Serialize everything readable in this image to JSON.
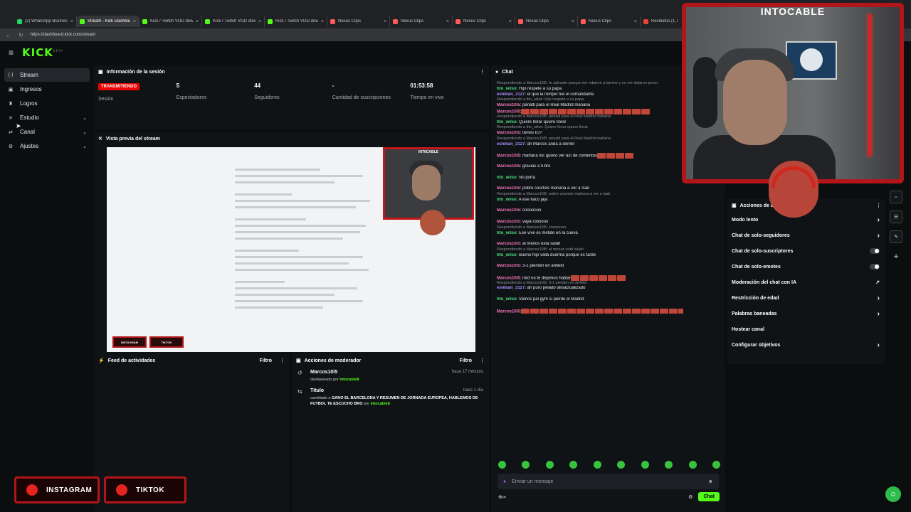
{
  "browser": {
    "tabs": [
      {
        "title": "(2) WhatsApp Business",
        "color": "#25d366",
        "active": false
      },
      {
        "title": "Stream - Kick Dashboard",
        "color": "#53fc18",
        "active": true
      },
      {
        "title": "Kick / Twitch VOD dow",
        "color": "#53fc18",
        "active": false
      },
      {
        "title": "Kick / Twitch VOD dow",
        "color": "#53fc18",
        "active": false
      },
      {
        "title": "Kick / Twitch VOD dow",
        "color": "#53fc18",
        "active": false
      },
      {
        "title": "Nexus Clips",
        "color": "#ff5a5a",
        "active": false
      },
      {
        "title": "Nexus Clips",
        "color": "#ff5a5a",
        "active": false
      },
      {
        "title": "Nexus Clips",
        "color": "#ff5a5a",
        "active": false
      },
      {
        "title": "Nexus Clips",
        "color": "#ff5a5a",
        "active": false
      },
      {
        "title": "Nexus Clips",
        "color": "#ff5a5a",
        "active": false
      },
      {
        "title": "Recibidos (1,7",
        "color": "#ea4335",
        "active": false
      }
    ],
    "url": "https://dashboard.kick.com/stream"
  },
  "app": {
    "logo": "KICK",
    "logo_sup": "BETA"
  },
  "sidebar": {
    "items": [
      {
        "label": "Stream",
        "icon": "stream-icon",
        "glyph": "(·)",
        "active": true,
        "chevron": false
      },
      {
        "label": "Ingresos",
        "icon": "revenue-icon",
        "glyph": "▣",
        "active": false,
        "chevron": false
      },
      {
        "label": "Logros",
        "icon": "trophy-icon",
        "glyph": "♜",
        "active": false,
        "chevron": false
      },
      {
        "label": "Estudio",
        "icon": "studio-icon",
        "glyph": "✕",
        "active": false,
        "chevron": true
      },
      {
        "label": "Canal",
        "icon": "channel-icon",
        "glyph": "⇄",
        "active": false,
        "chevron": true
      },
      {
        "label": "Ajustes",
        "icon": "gear-icon",
        "glyph": "⚙",
        "active": false,
        "chevron": true
      }
    ]
  },
  "session": {
    "title": "Información de la sesión",
    "live_label": "TRANSMITIENDO",
    "session_label": "Sesión",
    "stats": [
      {
        "value": "5",
        "label": "Espectadores"
      },
      {
        "value": "44",
        "label": "Seguidores"
      },
      {
        "value": "-",
        "label": "Cantidad de suscripciones"
      },
      {
        "value": "01:53:58",
        "label": "Tiempo en vivo"
      }
    ]
  },
  "preview": {
    "title": "Vista previa del stream",
    "cam_title": "INT6CABLE",
    "buttons": [
      "INSTAGRAM",
      "TIKTOK"
    ]
  },
  "activity": {
    "title": "Feed de actividades",
    "filter": "Filtro"
  },
  "moderation": {
    "title": "Acciones de moderador",
    "filter": "Filtro",
    "items": [
      {
        "title": "Marcos10i5",
        "time": "hace 17 minutos",
        "pre": "desbaneado por ",
        "highlight": "",
        "mid": "",
        "by": "Intocable8"
      },
      {
        "title": "Título",
        "time": "hace 1 día",
        "pre": "cambiado a ",
        "highlight": "GANO EL BARCELONA Y RESUMEN DE JORNADA EUROPEA, HABLEMOS DE FUTBOL TE ESCUCHO BRO",
        "mid": " por ",
        "by": "Intocable8"
      }
    ]
  },
  "chat": {
    "title": "Chat",
    "messages": [
      {
        "reply": "Respondiendo a Marcos10i5: te salvaste porque me robaron a lamine y no me dejaron poner"
      },
      {
        "user": "tito_wilso",
        "color": "#4ade80",
        "text": ": Hijo respete a su papa"
      },
      {
        "user": "esteban_3127",
        "color": "#a78bfa",
        "text": ": el que la rompió fue el comandante"
      },
      {
        "reply": "Respondiendo a tito_wilso: Hijo respeta a su papa"
      },
      {
        "user": "Marcos10i5",
        "color": "#f472b6",
        "text": ": penalti para el Real Madrid mañana"
      },
      {
        "user": "Marcos10i5",
        "color": "#f472b6",
        "text": ":",
        "emotes": 14
      },
      {
        "reply": "Respondiendo a Marcos10i5: penalti para el Real Madrid mañana"
      },
      {
        "user": "tito_wilso",
        "color": "#4ade80",
        "text": ": Quiere llorar quiere llorar"
      },
      {
        "reply": "Respondiendo a tito_wilso: Quiere llorar quiere llorar"
      },
      {
        "user": "Marcos10i5",
        "color": "#f472b6",
        "text": ": tienes IG?"
      },
      {
        "reply": "Respondiendo a Marcos10i5: penalti para el Real Madrid mañana"
      },
      {
        "user": "esteban_3127",
        "color": "#a78bfa",
        "text": ": ah Marcos anda a dormir"
      },
      {
        "reply": ""
      },
      {
        "user": "Marcos10i5",
        "color": "#f472b6",
        "text": ": mañana los quiero ver así de contentos",
        "emotes": 4
      },
      {
        "reply": ""
      },
      {
        "user": "Marcos10i5",
        "color": "#f472b6",
        "text": ": gracias a ti bro"
      },
      {
        "reply": ""
      },
      {
        "user": "tito_wilso",
        "color": "#4ade80",
        "text": ": No porfa"
      },
      {
        "reply": ""
      },
      {
        "user": "Marcos10i5",
        "color": "#f472b6",
        "text": ": pobre courtois mañana a ver a Isak"
      },
      {
        "reply": "Respondiendo a Marcos10i5: pobre courtois mañana a ver a Isak"
      },
      {
        "user": "tito_wilso",
        "color": "#4ade80",
        "text": ": A ese flaco jaja"
      },
      {
        "reply": ""
      },
      {
        "user": "Marcos10i5",
        "color": "#f472b6",
        "text": ": cooooooo"
      },
      {
        "reply": ""
      },
      {
        "user": "Marcos10i5",
        "color": "#f472b6",
        "text": ": vaya roboooo"
      },
      {
        "reply": "Respondiendo a Marcos10i5: cooooooo"
      },
      {
        "user": "tito_wilso",
        "color": "#4ade80",
        "text": ": Ese vive es metido en la cueva"
      },
      {
        "reply": ""
      },
      {
        "user": "Marcos10i5",
        "color": "#f472b6",
        "text": ": al menos está salah"
      },
      {
        "reply": "Respondiendo a Marcos10i5: al menos está salah"
      },
      {
        "user": "tito_wilso",
        "color": "#4ade80",
        "text": ": Bueno hijo valla duerma porque es tarde"
      },
      {
        "reply": ""
      },
      {
        "user": "Marcos10i5",
        "color": "#f472b6",
        "text": ": 3-1 pierden en anfield"
      },
      {
        "reply": ""
      },
      {
        "user": "Marcos10i5",
        "color": "#f472b6",
        "text": ": mrd no te dejamos hablar",
        "emotes": 6
      },
      {
        "reply": "Respondiendo a Marcos10i5: 3-1 pierden en anfield"
      },
      {
        "user": "esteban_3127",
        "color": "#a78bfa",
        "text": ": ah puro pelado desactualizado"
      },
      {
        "reply": ""
      },
      {
        "user": "tito_wilso",
        "color": "#4ade80",
        "text": ": Vamos pal gym si pierde el Madrid"
      },
      {
        "reply": ""
      },
      {
        "user": "Marcos10i5",
        "color": "#f472b6",
        "text": ":",
        "emotes": 18
      }
    ],
    "input_placeholder": "Enviar un mensaje",
    "send_label": "Chat"
  },
  "actions_panel": {
    "title": "Acciones de cai",
    "items": [
      {
        "label": "Modo lento",
        "control": "chevron"
      },
      {
        "label": "Chat de solo-seguidores",
        "control": "chevron"
      },
      {
        "label": "Chat de solo-suscriptores",
        "control": "toggle"
      },
      {
        "label": "Chat de solo-emotes",
        "control": "toggle"
      },
      {
        "label": "Moderación del chat con IA",
        "control": "link"
      },
      {
        "label": "Restricción de edad",
        "control": "chevron"
      },
      {
        "label": "Palabras baneadas",
        "control": "chevron"
      },
      {
        "label": "Hostear canal",
        "control": "none"
      },
      {
        "label": "Configurar objetivos",
        "control": "chevron"
      }
    ]
  },
  "webcam": {
    "title": "INTOCABLE"
  },
  "social": {
    "instagram": "INSTAGRAM",
    "tiktok": "TIKTOK"
  },
  "colors": {
    "kick_green": "#53fc18",
    "live_red": "#eb0400",
    "frame_red": "#b3161a"
  }
}
